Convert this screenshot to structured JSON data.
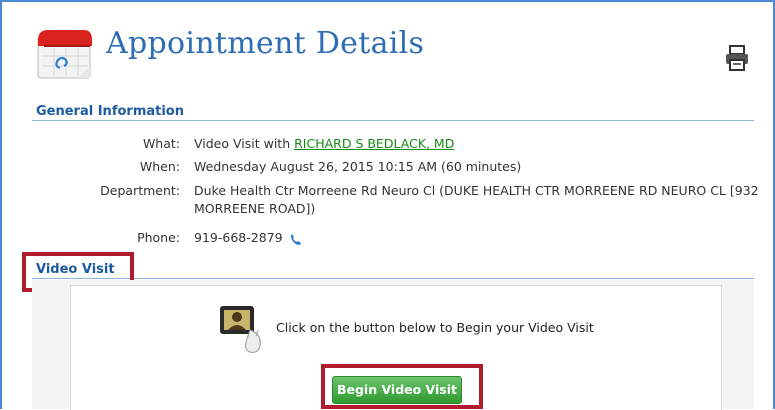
{
  "page": {
    "title": "Appointment Details"
  },
  "general": {
    "heading": "General Information",
    "what_label": "What:",
    "what_prefix": "Video Visit with",
    "provider": "RICHARD S BEDLACK, MD",
    "when_label": "When:",
    "when_value": "Wednesday August 26, 2015 10:15 AM (60 minutes)",
    "dept_label": "Department:",
    "dept_line1": "Duke Health Ctr Morreene Rd Neuro Cl (DUKE HEALTH CTR MORREENE RD NEURO CL [932",
    "dept_line2": "MORREENE ROAD])",
    "phone_label": "Phone:",
    "phone_value": "919-668-2879"
  },
  "video": {
    "heading": "Video Visit",
    "instruction": "Click on the button below to Begin your Video Visit",
    "button_label": "Begin Video Visit"
  },
  "colors": {
    "title": "#2e6db6",
    "link": "#1a8a1a",
    "highlight": "#b01c2e",
    "button": "#3aa43a"
  },
  "icons": [
    "calendar-icon",
    "printer-icon",
    "phone-icon",
    "video-camera-icon"
  ]
}
